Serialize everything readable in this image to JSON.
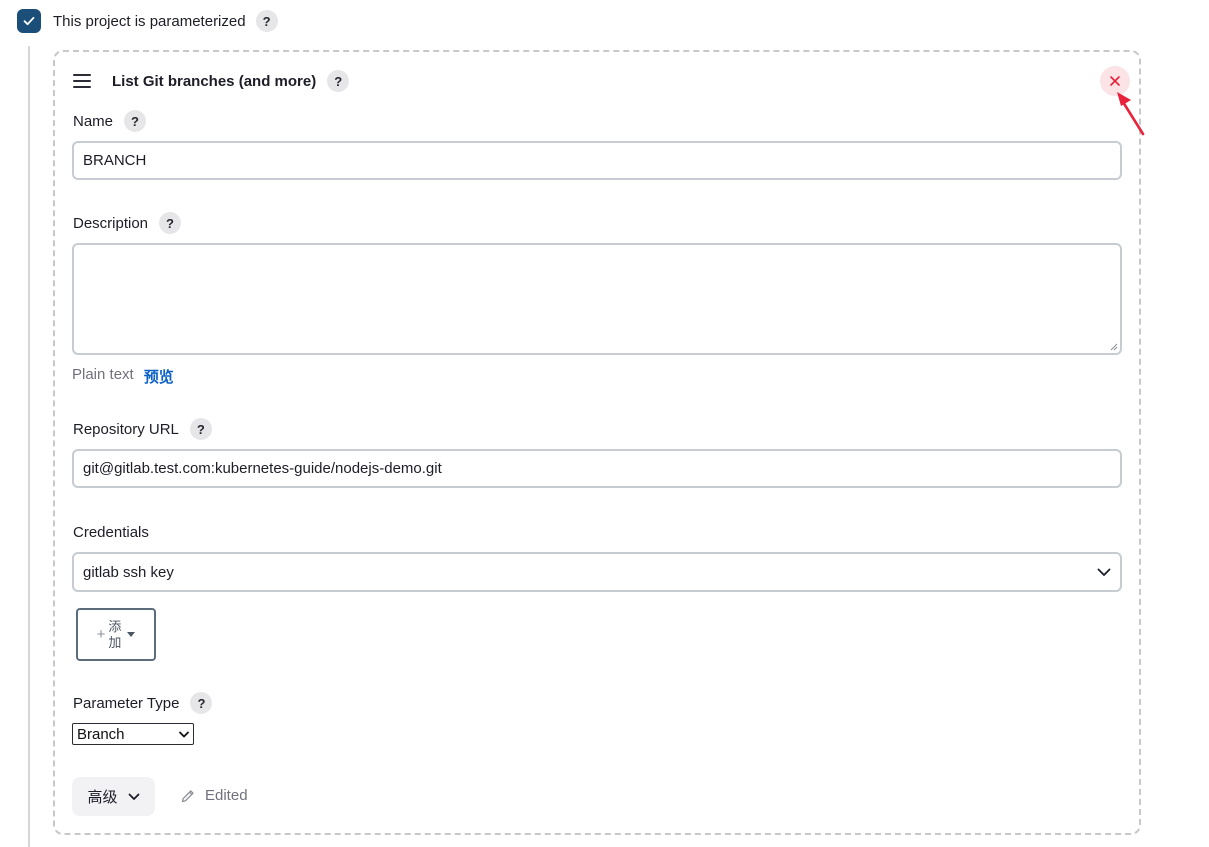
{
  "parameterized": {
    "label": "This project is parameterized",
    "checked": true,
    "help": "?"
  },
  "parameter": {
    "title": "List Git branches (and more)",
    "help": "?",
    "name": {
      "label": "Name",
      "help": "?",
      "value": "BRANCH"
    },
    "description": {
      "label": "Description",
      "help": "?",
      "value": "",
      "plain_text": "Plain text",
      "preview": "预览"
    },
    "repository_url": {
      "label": "Repository URL",
      "help": "?",
      "value": "git@gitlab.test.com:kubernetes-guide/nodejs-demo.git"
    },
    "credentials": {
      "label": "Credentials",
      "selected": "gitlab ssh key",
      "add_plus": "+",
      "add_line1": "添",
      "add_line2": "加"
    },
    "parameter_type": {
      "label": "Parameter Type",
      "help": "?",
      "selected": "Branch"
    },
    "advanced_label": "高级",
    "edited_label": "Edited"
  },
  "colors": {
    "checkbox": "#1c4e7a",
    "link": "#0d62c9",
    "close": "#e8223a",
    "close_bg": "#fbe3e6",
    "annotation_arrow": "#e8223a"
  },
  "icons": [
    "check-icon",
    "menu-icon",
    "close-icon",
    "chevron-down-icon",
    "caret-down-icon",
    "pencil-icon",
    "annotation-arrow"
  ]
}
